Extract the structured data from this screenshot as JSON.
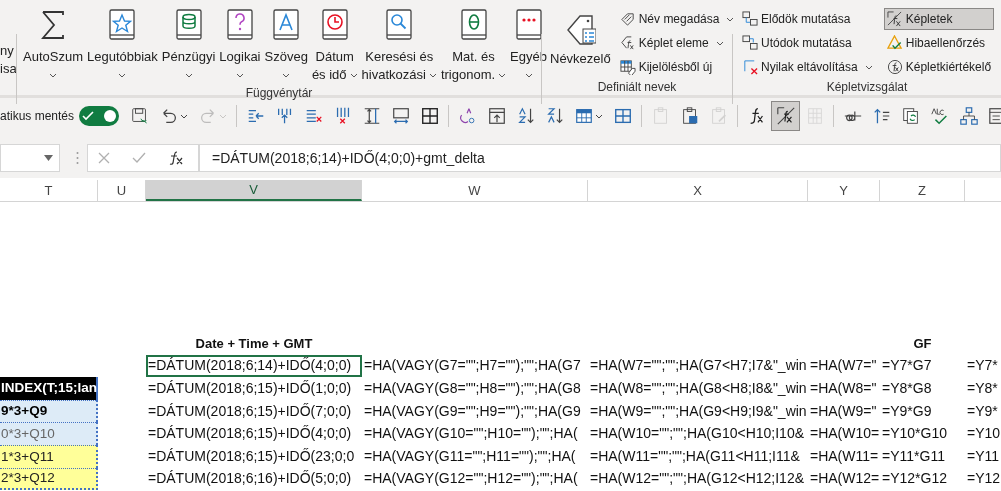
{
  "ribbon": {
    "partial_group": {
      "lines": [
        "ny",
        "isa"
      ]
    },
    "groups": [
      {
        "label": "Függvénytár",
        "large_buttons": [
          {
            "kind": "autosum",
            "lines": [
              "AutoSzum"
            ],
            "dropdown": true
          },
          {
            "kind": "recent",
            "lines": [
              "Legutóbbiak"
            ],
            "dropdown": true
          },
          {
            "kind": "financial",
            "lines": [
              "Pénzügyi"
            ],
            "dropdown": true
          },
          {
            "kind": "logical",
            "lines": [
              "Logikai"
            ],
            "dropdown": true
          },
          {
            "kind": "text",
            "lines": [
              "Szöveg"
            ],
            "dropdown": true
          },
          {
            "kind": "datetime",
            "lines": [
              "Dátum",
              "és idő"
            ],
            "dropdown": true
          },
          {
            "kind": "lookup",
            "lines": [
              "Keresési és",
              "hivatkozási"
            ],
            "dropdown": true
          },
          {
            "kind": "math",
            "lines": [
              "Mat. és",
              "trigonom."
            ],
            "dropdown": true
          },
          {
            "kind": "more",
            "lines": [
              "Egyéb"
            ],
            "dropdown": true
          }
        ]
      },
      {
        "label": "Definiált nevek",
        "large_buttons": [
          {
            "kind": "name-manager",
            "lines": [
              "Névkezelő"
            ],
            "dropdown": false
          }
        ],
        "small_columns": [
          [
            {
              "kind": "define-name",
              "label": "Név megadása",
              "dropdown": true,
              "selected": false
            },
            {
              "kind": "use-in-formula",
              "label": "Képlet eleme",
              "dropdown": true,
              "selected": false
            },
            {
              "kind": "from-selection",
              "label": "Kijelölésből új",
              "dropdown": false,
              "selected": false
            }
          ]
        ]
      },
      {
        "label": "Képletvizsgálat",
        "small_columns": [
          [
            {
              "kind": "precedents",
              "label": "Elődök mutatása",
              "dropdown": false,
              "selected": false
            },
            {
              "kind": "dependents",
              "label": "Utódok mutatása",
              "dropdown": false,
              "selected": false
            },
            {
              "kind": "remove-arrows",
              "label": "Nyilak eltávolítása",
              "dropdown": true,
              "selected": false
            }
          ],
          [
            {
              "kind": "show-formulas",
              "label": "Képletek",
              "dropdown": false,
              "selected": true
            },
            {
              "kind": "error-check",
              "label": "Hibaellenőrzés",
              "dropdown": false,
              "selected": false
            },
            {
              "kind": "evaluate",
              "label": "Képletkiértékelő",
              "dropdown": false,
              "selected": false
            }
          ]
        ]
      }
    ]
  },
  "quick_access": {
    "autosave_label": "atikus mentés",
    "autosave_on": true,
    "buttons": [
      {
        "kind": "save",
        "dropdown": false,
        "selected": false,
        "disabled": false
      },
      {
        "kind": "undo",
        "dropdown": true,
        "selected": false,
        "disabled": false
      },
      {
        "kind": "redo",
        "dropdown": true,
        "selected": false,
        "disabled": true
      },
      {
        "kind": "separator"
      },
      {
        "kind": "indent",
        "dropdown": false,
        "selected": false,
        "disabled": false
      },
      {
        "kind": "insert-column",
        "dropdown": false,
        "selected": false,
        "disabled": false
      },
      {
        "kind": "delete-rows",
        "dropdown": false,
        "selected": false,
        "disabled": false
      },
      {
        "kind": "delete-columns",
        "dropdown": false,
        "selected": false,
        "disabled": false
      },
      {
        "kind": "row-height",
        "dropdown": false,
        "selected": false,
        "disabled": false
      },
      {
        "kind": "column-width",
        "dropdown": false,
        "selected": false,
        "disabled": false
      },
      {
        "kind": "borders",
        "dropdown": false,
        "selected": false,
        "disabled": false
      },
      {
        "kind": "separator"
      },
      {
        "kind": "spelling",
        "dropdown": false,
        "selected": false,
        "disabled": false
      },
      {
        "kind": "wrap",
        "dropdown": false,
        "selected": false,
        "disabled": false
      },
      {
        "kind": "sort-asc",
        "dropdown": false,
        "selected": false,
        "disabled": false
      },
      {
        "kind": "sort-desc",
        "dropdown": false,
        "selected": false,
        "disabled": false
      },
      {
        "kind": "table",
        "dropdown": true,
        "selected": false,
        "disabled": false
      },
      {
        "kind": "grid",
        "dropdown": false,
        "selected": false,
        "disabled": false
      },
      {
        "kind": "separator"
      },
      {
        "kind": "paste-values",
        "dropdown": false,
        "selected": false,
        "disabled": true
      },
      {
        "kind": "paste-picture",
        "dropdown": false,
        "selected": false,
        "disabled": false
      },
      {
        "kind": "paste-format",
        "dropdown": false,
        "selected": false,
        "disabled": true
      },
      {
        "kind": "separator"
      },
      {
        "kind": "insert-function",
        "dropdown": false,
        "selected": false,
        "disabled": false
      },
      {
        "kind": "show-formulas",
        "dropdown": false,
        "selected": true,
        "disabled": false
      },
      {
        "kind": "calculate",
        "dropdown": false,
        "selected": false,
        "disabled": true
      },
      {
        "kind": "separator"
      },
      {
        "kind": "strikethrough",
        "dropdown": false,
        "selected": false,
        "disabled": false
      },
      {
        "kind": "trace",
        "dropdown": false,
        "selected": false,
        "disabled": false
      },
      {
        "kind": "refresh",
        "dropdown": false,
        "selected": false,
        "disabled": false
      },
      {
        "kind": "spell-check",
        "dropdown": false,
        "selected": false,
        "disabled": false
      },
      {
        "kind": "hierarchy",
        "dropdown": false,
        "selected": false,
        "disabled": false
      },
      {
        "kind": "form",
        "dropdown": false,
        "selected": false,
        "disabled": false
      }
    ]
  },
  "formula_bar": {
    "formula": "=DÁTUM(2018;6;14)+IDŐ(4;0;0)+gmt_delta"
  },
  "sheet": {
    "columns": [
      {
        "label": "T",
        "selected": false
      },
      {
        "label": "U",
        "selected": false
      },
      {
        "label": "V",
        "selected": true
      },
      {
        "label": "W",
        "selected": false
      },
      {
        "label": "X",
        "selected": false
      },
      {
        "label": "Y",
        "selected": false
      },
      {
        "label": "Z",
        "selected": false
      }
    ],
    "rows": [
      {
        "V": {
          "text": "Date + Time + GMT",
          "kind": "heading",
          "selected": false
        },
        "Z": {
          "text": "GF",
          "kind": "heading",
          "selected": false
        }
      },
      {
        "V": {
          "text": "=DÁTUM(2018;6;14)+IDŐ(4;0;0)",
          "selected": true
        },
        "W": {
          "text": "=HA(VAGY(G7=\"\";H7=\"\");\"\";HA(G7",
          "selected": false
        },
        "X": {
          "text": "=HA(W7=\"\";\"\";HA(G7<H7;I7&\"_win",
          "selected": false
        },
        "Y": {
          "text": "=HA(W7=\"",
          "selected": false
        },
        "Z": {
          "text": "=Y7*G7",
          "selected": false
        },
        "next": {
          "text": "=Y7*",
          "selected": false
        }
      },
      {
        "T": {
          "text": "INDEX(T;15;lan",
          "kind": "header"
        },
        "V": {
          "text": "=DÁTUM(2018;6;15)+IDŐ(1;0;0)",
          "selected": false
        },
        "W": {
          "text": "=HA(VAGY(G8=\"\";H8=\"\");\"\";HA(G8",
          "selected": false
        },
        "X": {
          "text": "=HA(W8=\"\";\"\";HA(G8<H8;I8&\"_win",
          "selected": false
        },
        "Y": {
          "text": "=HA(W8=\"",
          "selected": false
        },
        "Z": {
          "text": "=Y8*G8",
          "selected": false
        },
        "next": {
          "text": "=Y8*",
          "selected": false
        }
      },
      {
        "T": {
          "text": "9*3+Q9",
          "kind": "blue-bold"
        },
        "V": {
          "text": "=DÁTUM(2018;6;15)+IDŐ(7;0;0)",
          "selected": false
        },
        "W": {
          "text": "=HA(VAGY(G9=\"\";H9=\"\");\"\";HA(G9",
          "selected": false
        },
        "X": {
          "text": "=HA(W9=\"\";\"\";HA(G9<H9;I9&\"_win",
          "selected": false
        },
        "Y": {
          "text": "=HA(W9=\"",
          "selected": false
        },
        "Z": {
          "text": "=Y9*G9",
          "selected": false
        },
        "next": {
          "text": "=Y9*",
          "selected": false
        }
      },
      {
        "T": {
          "text": "0*3+Q10",
          "kind": "blue-muted"
        },
        "V": {
          "text": "=DÁTUM(2018;6;15)+IDŐ(4;0;0)",
          "selected": false
        },
        "W": {
          "text": "=HA(VAGY(G10=\"\";H10=\"\");\"\";HA(",
          "selected": false
        },
        "X": {
          "text": "=HA(W10=\"\";\"\";HA(G10<H10;I10&",
          "selected": false
        },
        "Y": {
          "text": "=HA(W10=",
          "selected": false
        },
        "Z": {
          "text": "=Y10*G10",
          "selected": false
        },
        "next": {
          "text": "=Y10",
          "selected": false
        }
      },
      {
        "T": {
          "text": "1*3+Q11",
          "kind": "yellow"
        },
        "V": {
          "text": "=DÁTUM(2018;6;15)+IDŐ(23;0;0",
          "selected": false
        },
        "W": {
          "text": "=HA(VAGY(G11=\"\";H11=\"\");\"\";HA(",
          "selected": false
        },
        "X": {
          "text": "=HA(W11=\"\";\"\";HA(G11<H11;I11&",
          "selected": false
        },
        "Y": {
          "text": "=HA(W11=",
          "selected": false
        },
        "Z": {
          "text": "=Y11*G11",
          "selected": false
        },
        "next": {
          "text": "=Y11",
          "selected": false
        }
      },
      {
        "T": {
          "text": "2*3+Q12",
          "kind": "yellow"
        },
        "V": {
          "text": "=DÁTUM(2018;6;16)+IDŐ(5;0;0)",
          "selected": false
        },
        "W": {
          "text": "=HA(VAGY(G12=\"\";H12=\"\");\"\";HA(",
          "selected": false
        },
        "X": {
          "text": "=HA(W12=\"\";\"\";HA(G12<H12;I12&",
          "selected": false
        },
        "Y": {
          "text": "=HA(W12=",
          "selected": false
        },
        "Z": {
          "text": "=Y12*G12",
          "selected": false
        },
        "next": {
          "text": "=Y12",
          "selected": false
        }
      }
    ]
  }
}
